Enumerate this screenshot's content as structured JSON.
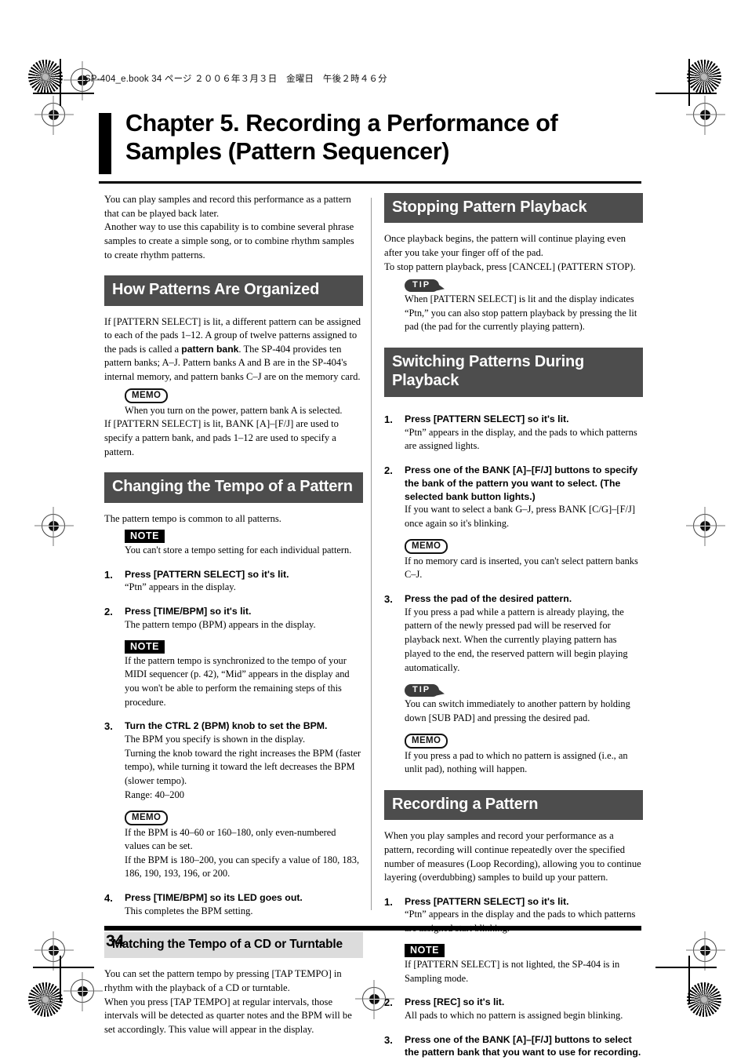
{
  "header": {
    "file_line": "SP-404_e.book  34 ページ  ２００６年３月３日　金曜日　午後２時４６分"
  },
  "chapter": {
    "title": "Chapter 5. Recording a Performance of Samples (Pattern Sequencer)"
  },
  "footer": {
    "page_number": "34"
  },
  "badges": {
    "memo": "MEMO",
    "note": "NOTE",
    "tip": "TIP"
  },
  "left_column": {
    "intro": {
      "p1": "You can play samples and record this performance as a pattern that can be played back later.",
      "p2": "Another way to use this capability is to combine several phrase samples to create a simple song, or to combine rhythm samples to create rhythm patterns."
    },
    "how_patterns": {
      "heading": "How Patterns Are Organized",
      "p1_a": "If [PATTERN SELECT] is lit, a different pattern can be assigned to each of the pads 1–12. A group of twelve patterns assigned to the pads is called a ",
      "p1_bold": "pattern bank",
      "p1_b": ". The SP-404 provides ten pattern banks; A–J. Pattern banks A and B are in the SP-404's internal memory, and pattern banks C–J are on the memory card.",
      "memo": "When you turn on the power, pattern bank A is selected.",
      "p2": "If [PATTERN SELECT] is lit, BANK [A]–[F/J] are used to specify a pattern bank, and pads 1–12 are used to specify a pattern."
    },
    "changing_tempo": {
      "heading": "Changing the Tempo of a Pattern",
      "intro": "The pattern tempo is common to all patterns.",
      "note": "You can't store a tempo setting for each individual pattern.",
      "steps": [
        {
          "num": "1.",
          "title": "Press [PATTERN SELECT] so it's lit.",
          "detail": "“Ptn” appears in the display."
        },
        {
          "num": "2.",
          "title": "Press [TIME/BPM] so it's lit.",
          "detail": "The pattern tempo (BPM) appears in the display.",
          "note": "If the pattern tempo is synchronized to the tempo of your MIDI sequencer (p. 42), “Mid” appears in the display and you won't be able to perform the remaining steps of this procedure."
        },
        {
          "num": "3.",
          "title": "Turn the CTRL 2 (BPM) knob to set the BPM.",
          "detail": "The BPM you specify is shown in the display.",
          "detail2": "Turning the knob toward the right increases the BPM (faster tempo), while turning it toward the left decreases the BPM (slower tempo).",
          "detail3": "Range: 40–200",
          "memo1": "If the BPM is 40–60 or 160–180, only even-numbered values can be set.",
          "memo2": "If the BPM is 180–200, you can specify a value of 180, 183, 186, 190, 193, 196, or 200."
        },
        {
          "num": "4.",
          "title": "Press [TIME/BPM] so its LED goes out.",
          "detail": "This completes the BPM setting."
        }
      ]
    },
    "matching_tempo": {
      "heading": "Matching the Tempo of a CD or Turntable",
      "p1": "You can set the pattern tempo by pressing [TAP TEMPO] in rhythm with the playback of a CD or turntable.",
      "p2": "When you press [TAP TEMPO] at regular intervals, those intervals will be detected as quarter notes and the BPM will be set accordingly. This value will appear in the display."
    }
  },
  "right_column": {
    "stopping": {
      "heading": "Stopping Pattern Playback",
      "p1": "Once playback begins, the pattern will continue playing even after you take your finger off of the pad.",
      "p2": "To stop pattern playback, press [CANCEL] (PATTERN STOP).",
      "tip": "When [PATTERN SELECT] is lit and the display indicates “Ptn,” you can also stop pattern playback by pressing the lit pad (the pad for the currently playing pattern)."
    },
    "switching": {
      "heading": "Switching Patterns During Playback",
      "steps": [
        {
          "num": "1.",
          "title": "Press [PATTERN SELECT] so it's lit.",
          "detail": "“Ptn” appears in the display, and the pads to which patterns are assigned lights."
        },
        {
          "num": "2.",
          "title": "Press one of the BANK [A]–[F/J] buttons to specify the bank of the pattern you want to select. (The selected bank button lights.)",
          "detail": "If you want to select a bank G–J, press BANK [C/G]–[F/J] once again so it's blinking.",
          "memo": "If no memory card is inserted, you can't select pattern banks C–J."
        },
        {
          "num": "3.",
          "title": "Press the pad of the desired pattern.",
          "detail": "If you press a pad while a pattern is already playing, the pattern of the newly pressed pad will be reserved for playback next. When the currently playing pattern has played to the end, the reserved pattern will begin playing automatically.",
          "tip": "You can switch immediately to another pattern by holding down [SUB PAD] and pressing the desired pad.",
          "memo": "If you press a pad to which no pattern is assigned (i.e., an unlit pad), nothing will happen."
        }
      ]
    },
    "recording": {
      "heading": "Recording a Pattern",
      "intro": "When you play samples and record your performance as a pattern, recording will continue repeatedly over the specified number of measures (Loop Recording), allowing you to continue layering (overdubbing) samples to build up your pattern.",
      "steps": [
        {
          "num": "1.",
          "title": "Press [PATTERN SELECT] so it's lit.",
          "detail": "“Ptn” appears in the display and the pads to which patterns are assigned start blinking.",
          "note": "If [PATTERN SELECT] is not lighted, the SP-404 is in Sampling mode."
        },
        {
          "num": "2.",
          "title": "Press [REC] so it's lit.",
          "detail": "All pads to which no pattern is assigned begin blinking."
        },
        {
          "num": "3.",
          "title": "Press one of the BANK [A]–[F/J] buttons to select the pattern bank that you want to use for recording."
        }
      ]
    }
  }
}
